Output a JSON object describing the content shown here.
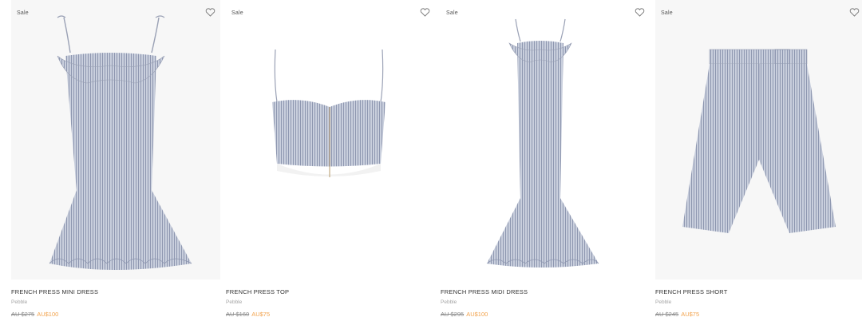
{
  "colors": {
    "sale_price": "#f2a34d",
    "old_price": "#8c8c8c",
    "fabric": "#b9c0d2"
  },
  "products": [
    {
      "badge": "Sale",
      "title": "FRENCH PRESS MINI DRESS",
      "variant": "Pebble",
      "old_price": "AU $275",
      "new_price": "AU$100",
      "icon": "heart-icon"
    },
    {
      "badge": "Sale",
      "title": "FRENCH PRESS TOP",
      "variant": "Pebble",
      "old_price": "AU $160",
      "new_price": "AU$75",
      "icon": "heart-icon"
    },
    {
      "badge": "Sale",
      "title": "FRENCH PRESS MIDI DRESS",
      "variant": "Pebble",
      "old_price": "AU $295",
      "new_price": "AU$100",
      "icon": "heart-icon"
    },
    {
      "badge": "Sale",
      "title": "FRENCH PRESS SHORT",
      "variant": "Pebble",
      "old_price": "AU $245",
      "new_price": "AU$75",
      "icon": "heart-icon"
    }
  ]
}
